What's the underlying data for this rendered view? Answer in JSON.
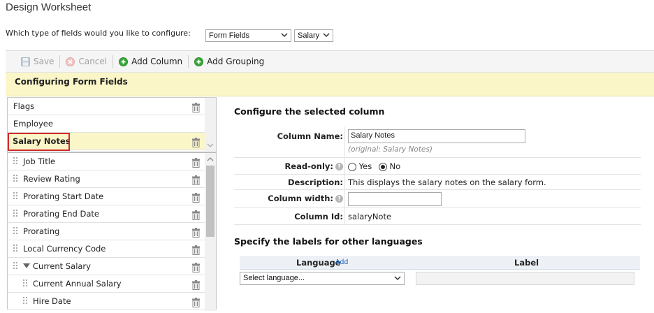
{
  "page": {
    "title": "Design Worksheet"
  },
  "config": {
    "question": "Which type of fields would you like to configure:",
    "field_type": "Form Fields",
    "form": "Salary"
  },
  "toolbar": {
    "save": "Save",
    "cancel": "Cancel",
    "add_column": "Add Column",
    "add_grouping": "Add Grouping"
  },
  "banner": {
    "text": "Configuring Form Fields"
  },
  "fixed_items": [
    {
      "label": "Flags"
    },
    {
      "label": "Employee"
    },
    {
      "label": "Salary Notes"
    }
  ],
  "columns": [
    {
      "label": "Job Title"
    },
    {
      "label": "Review Rating"
    },
    {
      "label": "Prorating Start Date"
    },
    {
      "label": "Prorating End Date"
    },
    {
      "label": "Prorating"
    },
    {
      "label": "Local Currency Code"
    },
    {
      "label": "Current Salary"
    },
    {
      "label": "Current Annual Salary"
    },
    {
      "label": "Hire Date"
    }
  ],
  "details": {
    "heading": "Configure the selected column",
    "column_name_label": "Column Name:",
    "column_name_value": "Salary Notes",
    "original": "(original: Salary Notes)",
    "readonly_label": "Read-only:",
    "yes": "Yes",
    "no": "No",
    "description_label": "Description:",
    "description_value": "This displays the salary notes on the salary form.",
    "width_label": "Column width:",
    "width_value": "",
    "id_label": "Column Id:",
    "id_value": "salaryNote"
  },
  "languages": {
    "heading": "Specify the labels for other languages",
    "col_language": "Language",
    "add": "Add",
    "col_label": "Label",
    "select_placeholder": "Select language..."
  },
  "colors": {
    "banner": "#fbf6c8",
    "highlight": "#d22a2a",
    "add_icon": "#3aa63a",
    "link": "#1a5fb4"
  }
}
